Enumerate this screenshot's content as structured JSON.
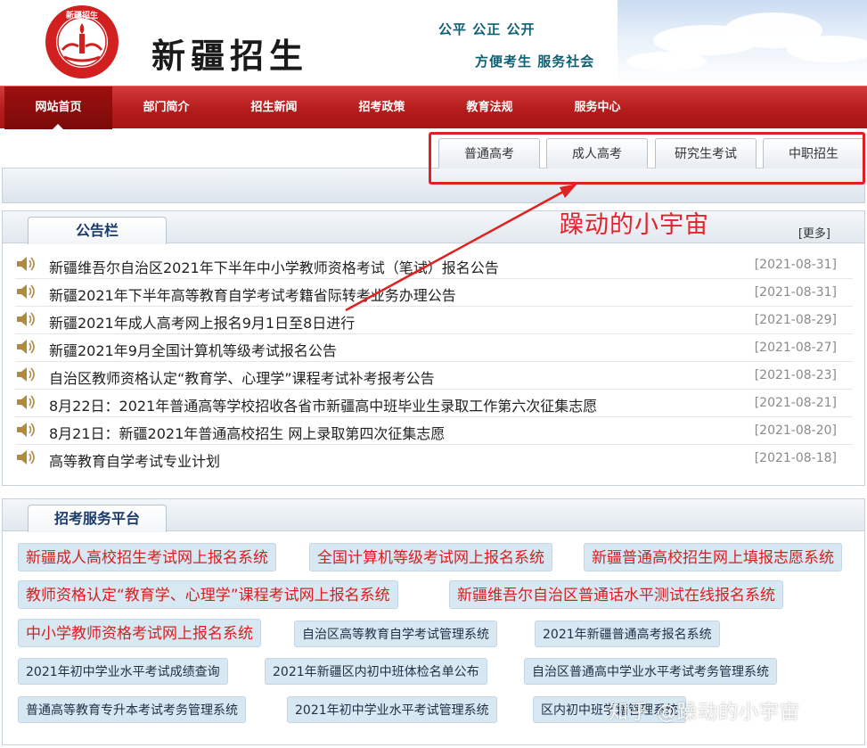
{
  "header": {
    "site_title": "新疆招生",
    "slogan_line1": "公平 公正 公开",
    "slogan_line2": "方便考生 服务社会",
    "logo_text": "新疆招生"
  },
  "nav": {
    "items": [
      {
        "label": "网站首页",
        "active": true
      },
      {
        "label": "部门简介",
        "active": false
      },
      {
        "label": "招生新闻",
        "active": false
      },
      {
        "label": "招考政策",
        "active": false
      },
      {
        "label": "教育法规",
        "active": false
      },
      {
        "label": "服务中心",
        "active": false
      }
    ]
  },
  "subtabs": [
    "普通高考",
    "成人高考",
    "研究生考试",
    "中职招生"
  ],
  "annotation": {
    "text": "躁动的小宇宙",
    "color": "#e3222d"
  },
  "notice": {
    "title": "公告栏",
    "more": "[更多]",
    "icon": "speaker-icon",
    "items": [
      {
        "title": "新疆维吾尔自治区2021年下半年中小学教师资格考试（笔试）报名公告",
        "date": "[2021-08-31]"
      },
      {
        "title": "新疆2021年下半年高等教育自学考试考籍省际转考业务办理公告",
        "date": "[2021-08-31]"
      },
      {
        "title": "新疆2021年成人高考网上报名9月1日至8日进行",
        "date": "[2021-08-29]"
      },
      {
        "title": "新疆2021年9月全国计算机等级考试报名公告",
        "date": "[2021-08-27]"
      },
      {
        "title": "自治区教师资格认定“教育学、心理学”课程考试补考报考公告",
        "date": "[2021-08-23]"
      },
      {
        "title": "8月22日：2021年普通高等学校招收各省市新疆高中班毕业生录取工作第六次征集志愿",
        "date": "[2021-08-21]"
      },
      {
        "title": "8月21日：新疆2021年普通高校招生 网上录取第四次征集志愿",
        "date": "[2021-08-20]"
      },
      {
        "title": "高等教育自学考试专业计划",
        "date": "[2021-08-18]"
      }
    ]
  },
  "services": {
    "title": "招考服务平台",
    "buttons": [
      "新疆成人高校招生考试网上报名系统",
      "全国计算机等级考试网上报名系统",
      "新疆普通高校招生网上填报志愿系统",
      "教师资格认定“教育学、心理学”课程考试网上报名系统",
      "新疆维吾尔自治区普通话水平测试在线报名系统",
      "中小学教师资格考试网上报名系统",
      "自治区高等教育自学考试管理系统",
      "2021年新疆普通高考报名系统",
      "2021年初中学业水平考试成绩查询",
      "2021年新疆区内初中班体检名单公布",
      "自治区普通高中学业水平考试考务管理系统",
      "普通高等教育专升本考试考务管理系统",
      "2021年初中学业水平考试管理系统",
      "区内初中班学籍管理系统"
    ]
  },
  "watermark": "知乎 @躁动的小宇宙",
  "colors": {
    "nav_red": "#b51c1c",
    "nav_active": "#8a0d0d",
    "highlight_box": "#e02121",
    "service_red_text": "#d81e1e",
    "service_btn_bg": "#d8e8f3",
    "date_gray": "#8a8a8a"
  }
}
